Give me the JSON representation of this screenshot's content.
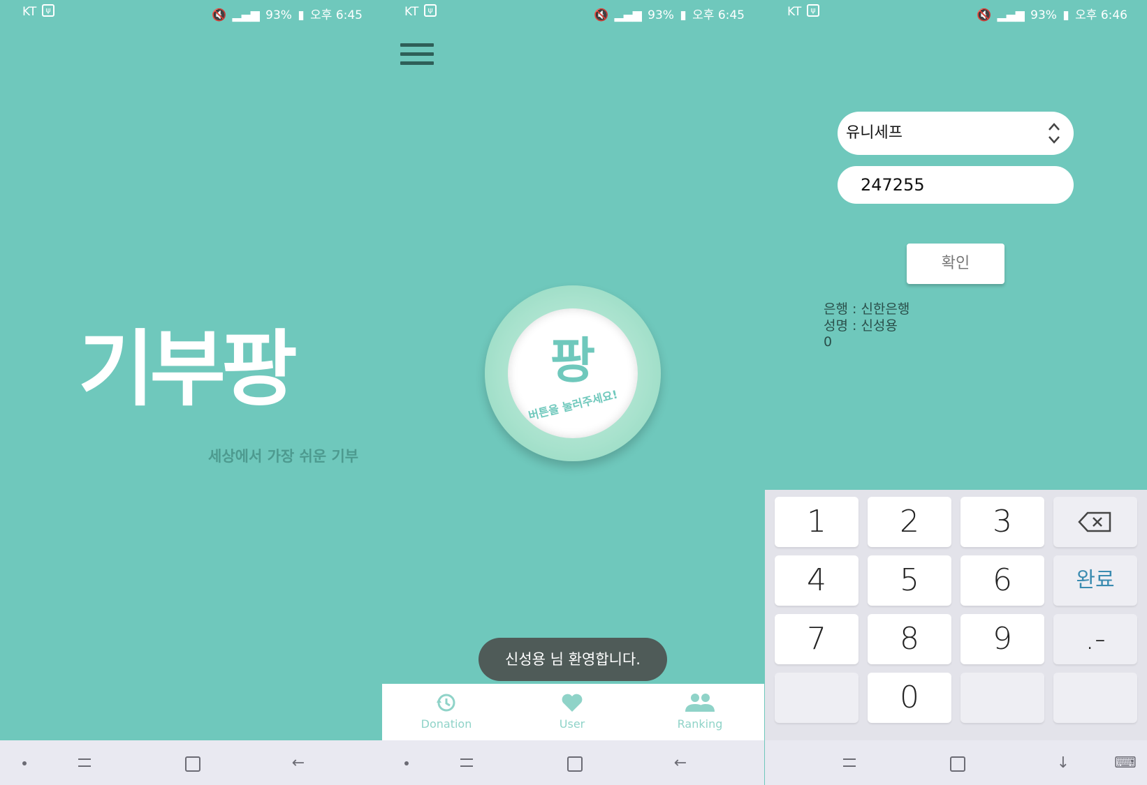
{
  "statusbar": {
    "screen1": {
      "carrier": "KT",
      "icons": "mute hd lte signal",
      "battery": "93%",
      "time": "오후 6:45"
    },
    "screen2": {
      "carrier": "KT",
      "icons": "mute hd lte signal",
      "battery": "93%",
      "time": "오후 6:45"
    },
    "screen3": {
      "carrier": "KT",
      "icons": "mute hd lte signal",
      "battery": "93%",
      "time": "오후 6:46"
    }
  },
  "splash": {
    "logo": "기부팡",
    "tagline": "세상에서 가장 쉬운 기부"
  },
  "main": {
    "button_char": "팡",
    "button_hint": "버튼을 눌러주세요!",
    "toast": "신성용 님 환영합니다.",
    "tabs": [
      {
        "label": "Donation",
        "icon": "history-icon"
      },
      {
        "label": "User",
        "icon": "heart-icon"
      },
      {
        "label": "Ranking",
        "icon": "people-icon"
      }
    ]
  },
  "donate": {
    "selected_org": "유니세프",
    "amount": "247255",
    "confirm_label": "확인",
    "bank_line": "은행 : 신한은행",
    "name_line": "성명 : 신성용",
    "balance": "0"
  },
  "keypad": {
    "keys": [
      "1",
      "2",
      "3",
      "⌫",
      "4",
      "5",
      "6",
      "완료",
      "7",
      "8",
      "9",
      ".-",
      "",
      "0",
      "",
      ""
    ]
  },
  "colors": {
    "background": "#6fc8bc",
    "accent": "#8fd3c8",
    "text_dark": "#2e5f58"
  }
}
